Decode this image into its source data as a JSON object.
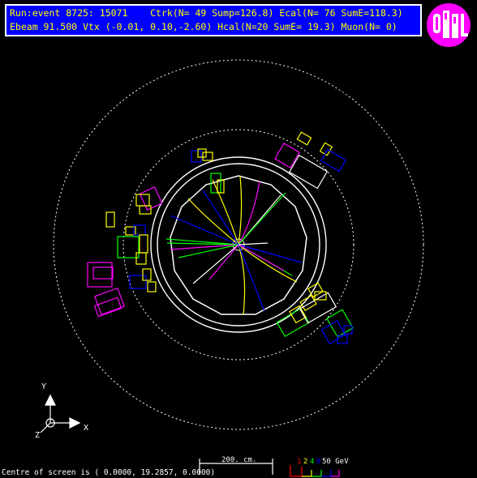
{
  "header": {
    "line1": "Run:event 8725: 15071    Ctrk(N= 49 Sump=126.8) Ecal(N= 76 SumE=118.3)",
    "line2": "Ebeam 91.500 Vtx (-0.01, 0.10,-2.60) Hcal(N=20 SumE= 19.3) Muon(N= 0)"
  },
  "axes": {
    "y_label": "Y",
    "x_label": "X",
    "z_label": "Z"
  },
  "scale_bar": {
    "label": "200. cm."
  },
  "energy_scale": {
    "labels": [
      "1",
      "2",
      "4",
      "8",
      "50 GeV"
    ],
    "colors": [
      "#ff0000",
      "#ffff00",
      "#00ff00",
      "#0000ff",
      "#ff00ff"
    ]
  },
  "footer": {
    "centre_text": "Centre of screen is (   0.0000,  19.2857,   0.0000)"
  },
  "logo": {
    "text": "OPAL"
  },
  "colors": {
    "header_bg": "#0000ff",
    "header_text": "#ffff00",
    "detector": "#ffffff"
  }
}
